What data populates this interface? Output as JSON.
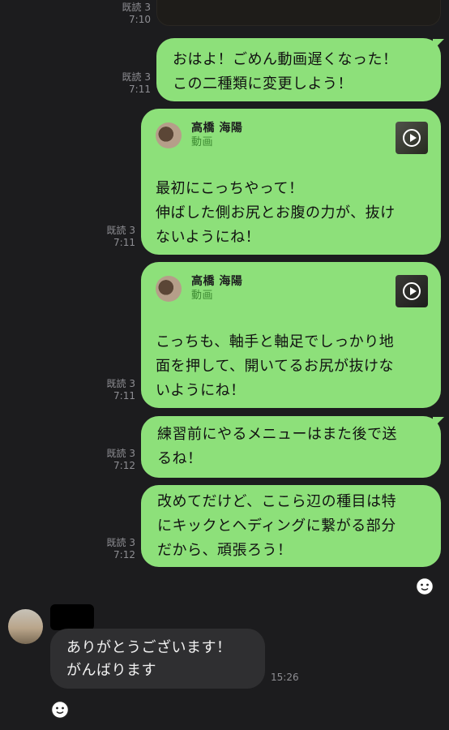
{
  "read_label": "既読 3",
  "messages": [
    {
      "time": "7:10"
    },
    {
      "time": "7:11",
      "text": "おはよ！ごめん動画遅くなった！\nこの二種類に変更しよう！"
    },
    {
      "time": "7:11",
      "media": {
        "sender": "高橋 海陽",
        "kind": "動画"
      },
      "text": "最初にこっちやって！\n伸ばした側お尻とお腹の力が、抜け\nないようにね！"
    },
    {
      "time": "7:11",
      "media": {
        "sender": "高橋 海陽",
        "kind": "動画"
      },
      "text": "こっちも、軸手と軸足でしっかり地\n面を押して、開いてるお尻が抜けな\nいようにね！"
    },
    {
      "time": "7:12",
      "text": "練習前にやるメニューはまた後で送\nるね！"
    },
    {
      "time": "7:12",
      "text": "改めてだけど、ここら辺の種目は特\nにキックとヘディングに繋がる部分\nだから、頑張ろう！"
    }
  ],
  "incoming": {
    "text": "ありがとうございます！\nがんばります",
    "time": "15:26"
  },
  "colors": {
    "background": "#1c1c1e",
    "outgoing_bubble": "#8de07a",
    "incoming_bubble": "#2f2f31"
  },
  "icons": [
    "play-icon",
    "smile-sticker-icon"
  ]
}
